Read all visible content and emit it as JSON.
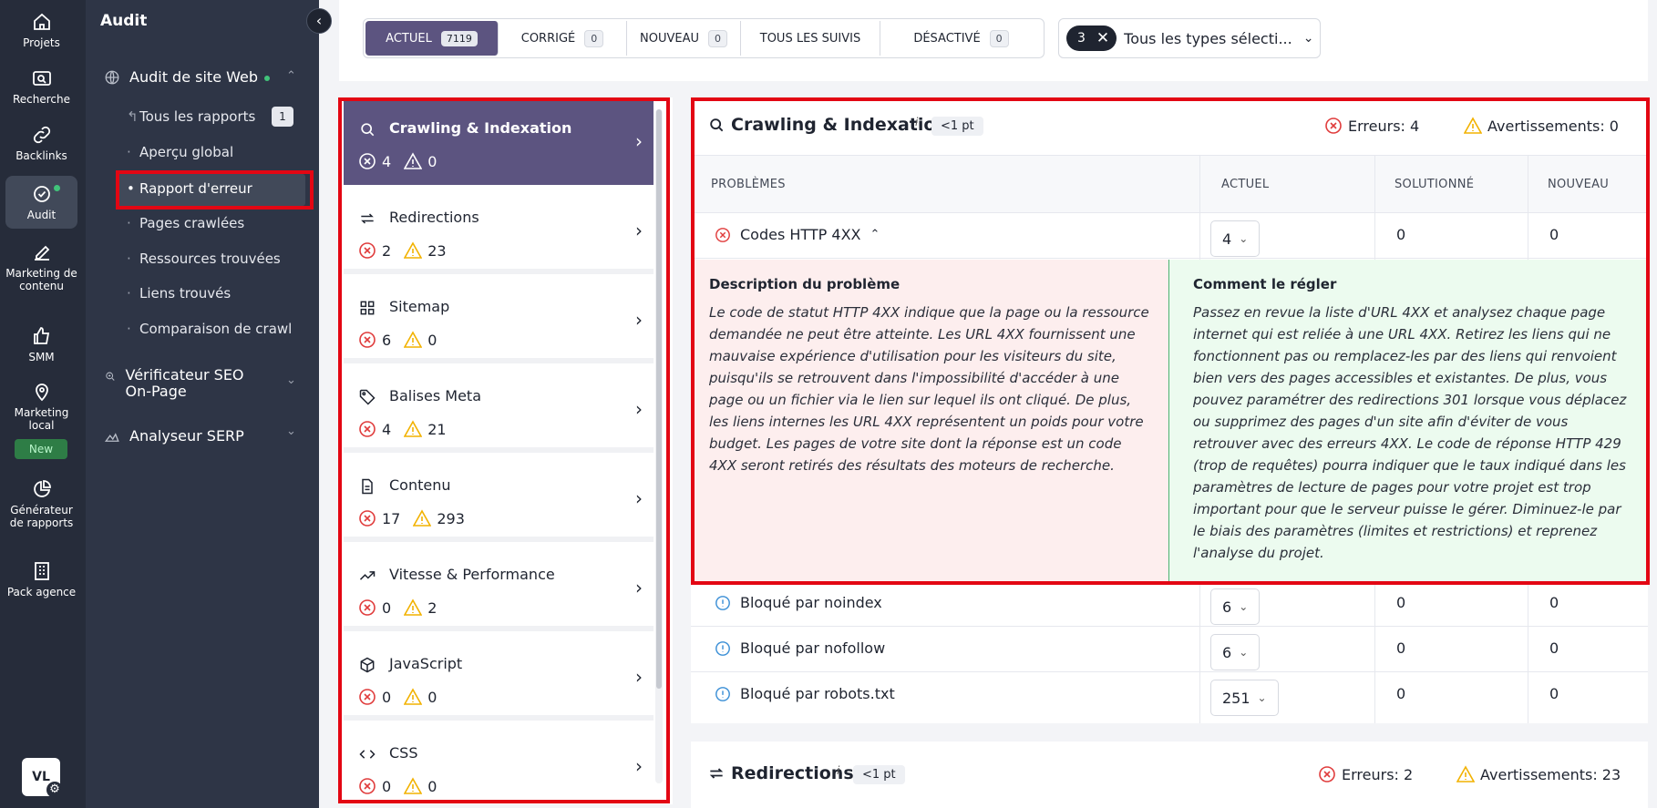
{
  "rail": {
    "items": [
      {
        "label": "Projets",
        "icon": "home-icon"
      },
      {
        "label": "Recherche",
        "icon": "search-icon"
      },
      {
        "label": "Backlinks",
        "icon": "link-icon"
      },
      {
        "label": "Audit",
        "icon": "check-circle-icon"
      },
      {
        "label": "Marketing de contenu",
        "icon": "edit-icon"
      },
      {
        "label": "SMM",
        "icon": "thumbs-up-icon"
      },
      {
        "label": "Marketing local",
        "icon": "location-icon"
      },
      {
        "label": "Générateur de rapports",
        "icon": "pie-chart-icon"
      },
      {
        "label": "Pack agence",
        "icon": "building-icon"
      }
    ],
    "new_badge": "New",
    "avatar": "VL"
  },
  "nav": {
    "title": "Audit",
    "collapse": "‹",
    "groups": [
      {
        "label": "Audit de site Web"
      },
      {
        "label": "Vérificateur SEO On-Page"
      },
      {
        "label": "Analyseur SERP"
      }
    ],
    "items": [
      {
        "label": "Tous les rapports",
        "badge": "1"
      },
      {
        "label": "Aperçu global"
      },
      {
        "label": "Rapport d'erreur"
      },
      {
        "label": "Pages crawlées"
      },
      {
        "label": "Ressources trouvées"
      },
      {
        "label": "Liens trouvés"
      },
      {
        "label": "Comparaison de crawl"
      }
    ]
  },
  "filters": {
    "tabs": [
      {
        "label": "Actuel",
        "count": "7119"
      },
      {
        "label": "Corrigé",
        "count": "0"
      },
      {
        "label": "Nouveau",
        "count": "0"
      },
      {
        "label": "Tous les suivis",
        "count": ""
      },
      {
        "label": "Désactivé",
        "count": "0"
      }
    ],
    "types_count": "3",
    "types_label": "Tous les types sélecti..."
  },
  "categories": [
    {
      "title": "Crawling & Indexation",
      "errors": "4",
      "warnings": "0"
    },
    {
      "title": "Redirections",
      "errors": "2",
      "warnings": "23"
    },
    {
      "title": "Sitemap",
      "errors": "6",
      "warnings": "0"
    },
    {
      "title": "Balises Meta",
      "errors": "4",
      "warnings": "21"
    },
    {
      "title": "Contenu",
      "errors": "17",
      "warnings": "293"
    },
    {
      "title": "Vitesse & Performance",
      "errors": "0",
      "warnings": "2"
    },
    {
      "title": "JavaScript",
      "errors": "0",
      "warnings": "0"
    },
    {
      "title": "CSS",
      "errors": "0",
      "warnings": "0"
    }
  ],
  "detail": {
    "title": "Crawling & Indexation",
    "info": "i",
    "points": "<1 pt",
    "errors_label": "Erreurs:",
    "errors_value": "4",
    "warnings_label": "Avertissements:",
    "warnings_value": "0",
    "columns": [
      "PROBLÈMES",
      "ACTUEL",
      "SOLUTIONNÉ",
      "NOUVEAU"
    ],
    "rows": [
      {
        "name": "Codes HTTP 4XX",
        "current": "4",
        "solved": "0",
        "new": "0"
      },
      {
        "name": "Bloqué par noindex",
        "current": "6",
        "solved": "0",
        "new": "0"
      },
      {
        "name": "Bloqué par nofollow",
        "current": "6",
        "solved": "0",
        "new": "0"
      },
      {
        "name": "Bloqué par robots.txt",
        "current": "251",
        "solved": "0",
        "new": "0"
      }
    ],
    "description_title": "Description du problème",
    "description_text": "Le code de statut HTTP 4XX indique que la page ou la ressource demandée ne peut être atteinte. Les URL 4XX fournissent une mauvaise expérience d'utilisation pour les visiteurs du site, puisqu'ils se retrouvent dans l'impossibilité d'accéder à une page ou un fichier via le lien sur lequel ils ont cliqué. De plus, les liens internes les URL 4XX représentent un poids pour votre budget. Les pages de votre site dont la réponse est un code 4XX seront retirés des résultats des moteurs de recherche.",
    "fix_title": "Comment le régler",
    "fix_text": "Passez en revue la liste d'URL 4XX et analysez chaque page internet qui est reliée à une URL 4XX. Retirez les liens qui ne fonctionnent pas ou remplacez-les par des liens qui renvoient bien vers des pages accessibles et existantes. De plus, vous pouvez paramétrer des redirections 301 lorsque vous déplacez ou supprimez des pages d'un site afin d'éviter de vous retrouver avec des erreurs 4XX. Le code de réponse HTTP 429 (trop de requêtes) pourra indiquer que le taux indiqué dans les paramètres de lecture de pages pour votre projet est trop important pour que le serveur puisse le gérer. Diminuez-le par le biais des paramètres (limites et restrictions) et reprenez l'analyse du projet."
  },
  "redirections": {
    "title": "Redirections",
    "info": "i",
    "points": "<1 pt",
    "errors_label": "Erreurs:",
    "errors_value": "2",
    "warnings_label": "Avertissements:",
    "warnings_value": "23"
  },
  "colors": {
    "accent": "#5c5480",
    "error": "#e03c3c",
    "warning": "#f2b200",
    "info": "#3b8fd6",
    "highlight": "#e30613"
  }
}
